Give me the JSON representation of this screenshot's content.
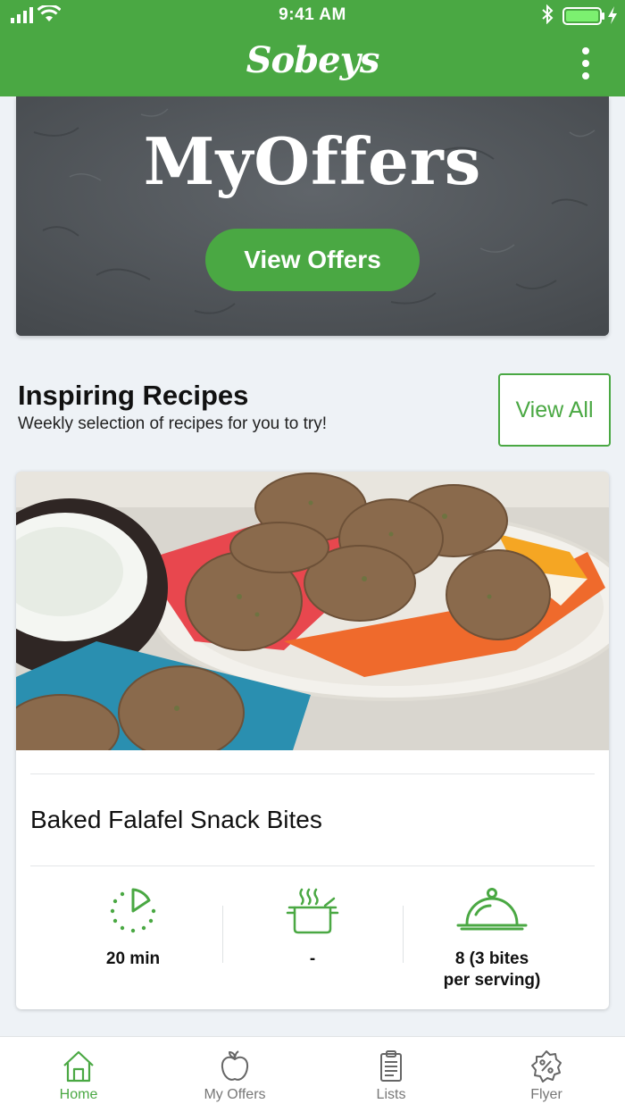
{
  "status_bar": {
    "time": "9:41 AM"
  },
  "header": {
    "logo_text": "Sobeys",
    "icon": "more-vertical-icon"
  },
  "banner": {
    "title": "MyOffers",
    "button_label": "View Offers"
  },
  "recipes_section": {
    "title": "Inspiring Recipes",
    "subtitle": "Weekly selection of recipes for you to try!",
    "view_all_label": "View All"
  },
  "recipe_card": {
    "title": "Baked Falafel Snack Bites",
    "stats": [
      {
        "icon": "timer-icon",
        "label": "20 min"
      },
      {
        "icon": "cooking-pot-icon",
        "label": "-"
      },
      {
        "icon": "serving-dish-icon",
        "label_line1": "8 (3 bites",
        "label_line2": "per serving)"
      }
    ]
  },
  "tabbar": {
    "tabs": [
      {
        "label": "Home",
        "icon": "home-icon",
        "active": true
      },
      {
        "label": "My Offers",
        "icon": "apple-icon",
        "active": false
      },
      {
        "label": "Lists",
        "icon": "clipboard-list-icon",
        "active": false
      },
      {
        "label": "Flyer",
        "icon": "discount-badge-icon",
        "active": false
      }
    ]
  },
  "colors": {
    "brand_green": "#4aa843",
    "background": "#eef2f6"
  }
}
